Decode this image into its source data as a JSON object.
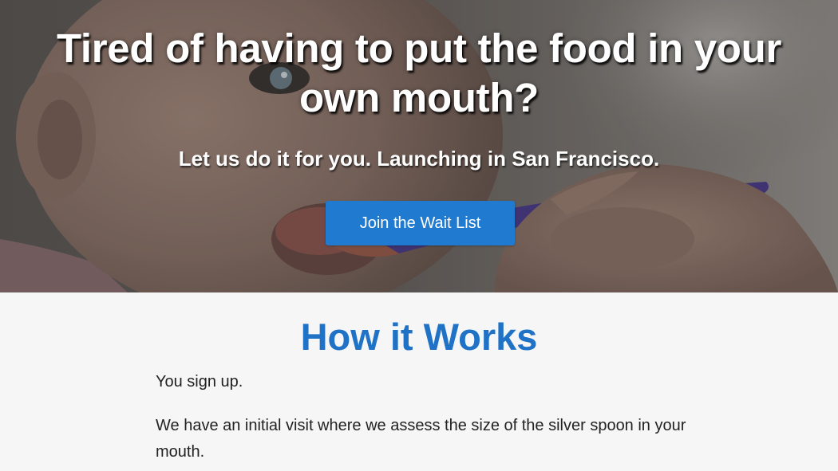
{
  "hero": {
    "title": "Tired of having to put the food in your own mouth?",
    "subtitle": "Let us do it for you. Launching in San Francisco.",
    "cta_label": "Join the Wait List",
    "image_description": "baby-being-spoon-fed-photo"
  },
  "how_it_works": {
    "title": "How it Works",
    "steps": [
      "You sign up.",
      "We have an initial visit where we assess the size of the silver spoon in your mouth."
    ]
  },
  "colors": {
    "accent_blue": "#1f7ad0",
    "heading_blue": "#1f72c6",
    "section_background": "#f6f6f6",
    "body_text": "#222222"
  }
}
